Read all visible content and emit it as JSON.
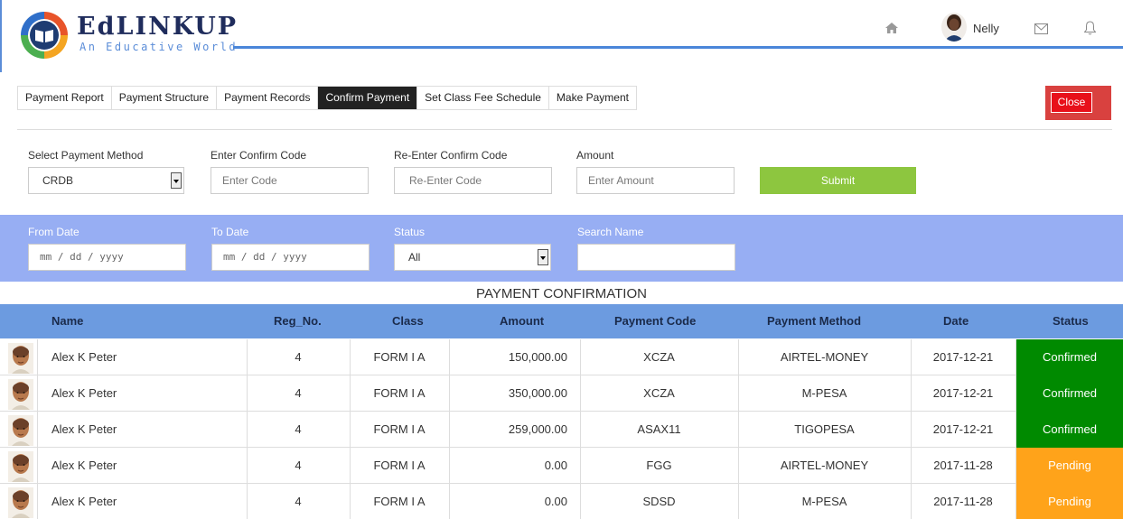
{
  "header": {
    "brand": "EdLINKUP",
    "tagline": "An Educative World",
    "user_name": "Nelly"
  },
  "tabs": [
    "Payment Report",
    "Payment Structure",
    "Payment Records",
    "Confirm Payment",
    "Set Class Fee Schedule",
    "Make Payment"
  ],
  "active_tab": "Confirm Payment",
  "close_label": "Close",
  "confirm_form": {
    "method_label": "Select Payment Method",
    "method_value": "CRDB",
    "code_label": "Enter Confirm Code",
    "code_placeholder": "Enter Code",
    "recode_label": "Re-Enter Confirm Code",
    "recode_placeholder": "Re-Enter Code",
    "amount_label": "Amount",
    "amount_placeholder": "Enter Amount",
    "submit_label": "Submit"
  },
  "filters": {
    "from_label": "From Date",
    "from_placeholder": "mm / dd / yyyy",
    "to_label": "To Date",
    "to_placeholder": "mm / dd / yyyy",
    "status_label": "Status",
    "status_value": "All",
    "search_label": "Search Name",
    "search_value": ""
  },
  "table": {
    "title": "PAYMENT CONFIRMATION",
    "columns": [
      "Name",
      "Reg_No.",
      "Class",
      "Amount",
      "Payment Code",
      "Payment Method",
      "Date",
      "Status"
    ],
    "rows": [
      {
        "name": "Alex K Peter",
        "reg": "4",
        "class": "FORM I A",
        "amount": "150,000.00",
        "code": "XCZA",
        "method": "AIRTEL-MONEY",
        "date": "2017-12-21",
        "status": "Confirmed"
      },
      {
        "name": "Alex K Peter",
        "reg": "4",
        "class": "FORM I A",
        "amount": "350,000.00",
        "code": "XCZA",
        "method": "M-PESA",
        "date": "2017-12-21",
        "status": "Confirmed"
      },
      {
        "name": "Alex K Peter",
        "reg": "4",
        "class": "FORM I A",
        "amount": "259,000.00",
        "code": "ASAX11",
        "method": "TIGOPESA",
        "date": "2017-12-21",
        "status": "Confirmed"
      },
      {
        "name": "Alex K Peter",
        "reg": "4",
        "class": "FORM I A",
        "amount": "0.00",
        "code": "FGG",
        "method": "AIRTEL-MONEY",
        "date": "2017-11-28",
        "status": "Pending"
      },
      {
        "name": "Alex K Peter",
        "reg": "4",
        "class": "FORM I A",
        "amount": "0.00",
        "code": "SDSD",
        "method": "M-PESA",
        "date": "2017-11-28",
        "status": "Pending"
      }
    ]
  },
  "colors": {
    "confirmed": "#008a00",
    "pending": "#ffa31a",
    "header_blue": "#6c9be0",
    "filter_blue": "#97aef3",
    "submit_green": "#8dc63f",
    "close_red": "#e8101a"
  }
}
